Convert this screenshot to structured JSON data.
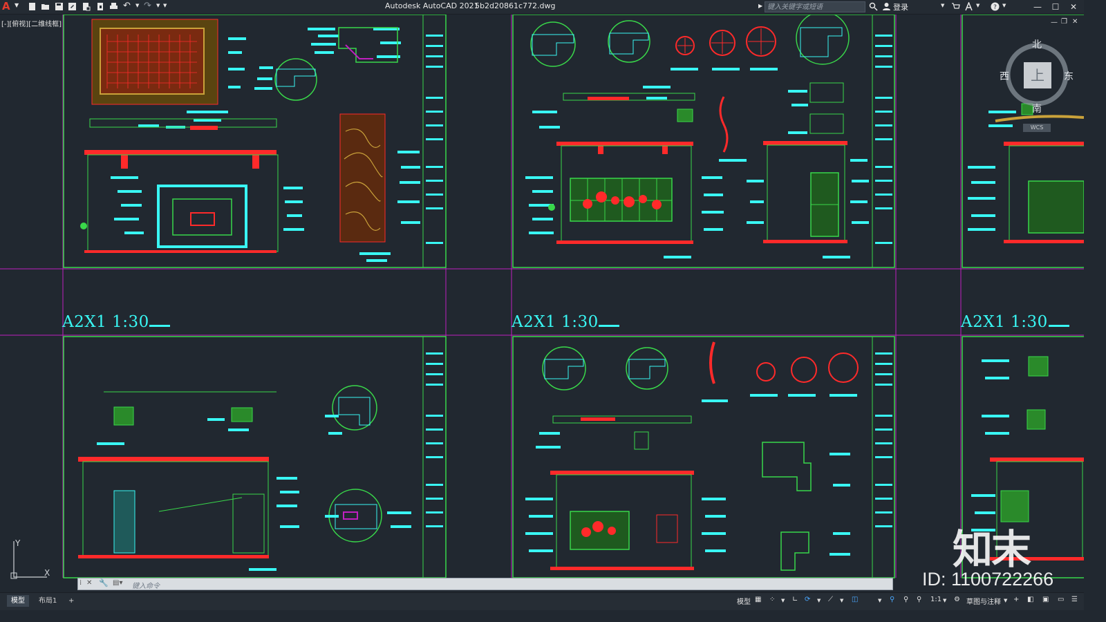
{
  "app": {
    "title": "Autodesk AutoCAD 2021",
    "filename": "5b2d20861c772.dwg",
    "app_letter": "A"
  },
  "search": {
    "placeholder": "键入关键字或短语"
  },
  "account": {
    "login_label": "登录"
  },
  "viewport": {
    "view_label": "[-][俯视][二维线框]",
    "scale_labels": [
      "A2X1 1:30",
      "A2X1 1:30",
      "A2X1 1:30"
    ]
  },
  "viewcube": {
    "north": "北",
    "south": "南",
    "east": "东",
    "west": "西",
    "top": "上",
    "wcs": "WCS"
  },
  "ucs": {
    "x": "X",
    "y": "Y"
  },
  "command_line": {
    "placeholder": "键入命令"
  },
  "layout_tabs": [
    {
      "label": "模型",
      "active": true
    },
    {
      "label": "布局1",
      "active": false
    },
    {
      "label": "+",
      "active": false
    }
  ],
  "status_bar": {
    "model_label": "模型",
    "scale": "1:1",
    "workspace": "草图与注释"
  },
  "watermark": {
    "logo": "知末",
    "id": "ID: 1100722266"
  },
  "colors": {
    "background": "#212830",
    "cyan": "#39f7f4",
    "green": "#39d84a",
    "red": "#ff2a2a",
    "magenta": "#c020c0"
  }
}
